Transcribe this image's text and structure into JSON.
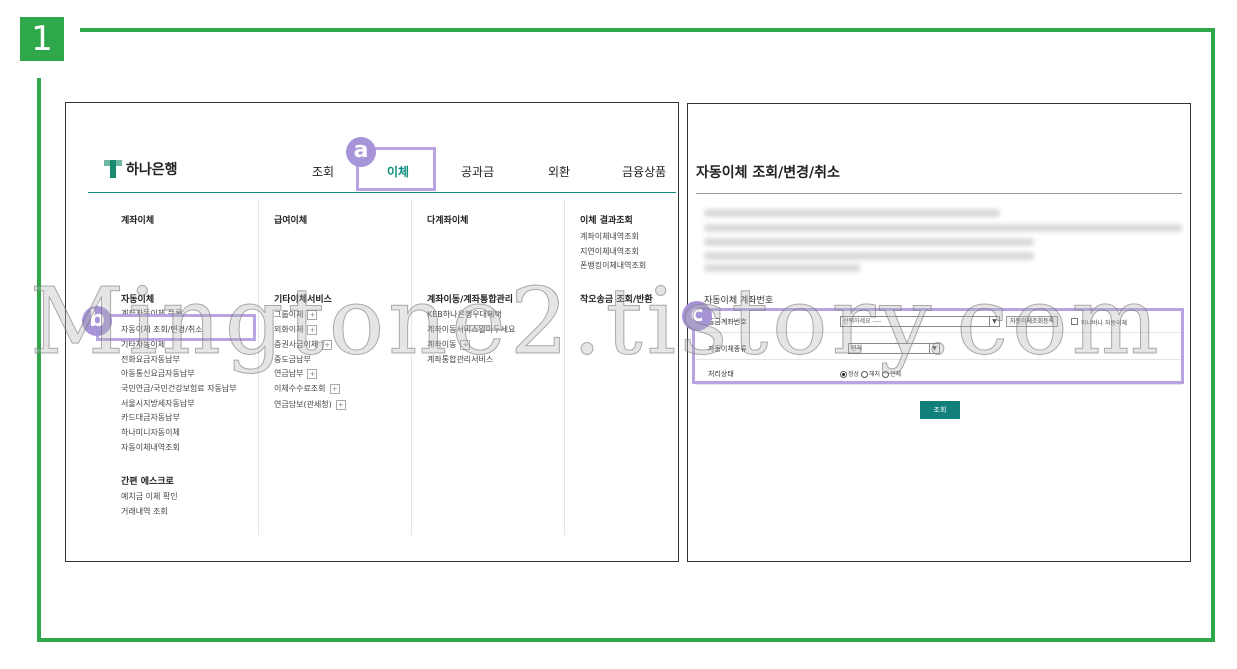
{
  "step": {
    "number": "1"
  },
  "colors": {
    "frame": "#2ea84a",
    "accent": "#0e8d7e",
    "highlight": "#b7a4e0",
    "button": "#11807a"
  },
  "markers": {
    "a": "a",
    "b": "b",
    "c": "c"
  },
  "bank": {
    "logo_icon": "hana-logo-icon",
    "logo_text": "하나은행",
    "nav": [
      "조회",
      "이체",
      "공과금",
      "외환",
      "금융상품"
    ],
    "active_nav": "이체",
    "menu": {
      "col1_head": "계좌이체",
      "col1_head2": "자동이체",
      "col1_items": [
        "계좌자동이체 등록",
        "자동이체 조회/변경/취소",
        "기타자동이체",
        "전화요금자동납부",
        "아동통신요금자동납부",
        "국민연금/국민건강보험료 자동납부",
        "서울시지방세자동납부",
        "카드대금자동납부",
        "하나미니자동이체",
        "자동이체내역조회"
      ],
      "col1_head3": "간편 에스크로",
      "col1_items2": [
        "예치금 이체 확인",
        "거래내역 조회"
      ],
      "col2_head": "급여이체",
      "col2_head2": "기타이체서비스",
      "col2_items": [
        "그룹이체",
        "외화이체",
        "증권사금이체",
        "중도금납부",
        "연금납부",
        "이체수수료조회",
        "연금담보(관세청)"
      ],
      "col3_head": "다계좌이체",
      "col3_head2": "계좌이동/계좌통합관리",
      "col3_items": [
        "KEB하나은행우대혜택",
        "계좌이동서비스알아두세요",
        "계좌이동",
        "계좌통합관리서비스"
      ],
      "col4_head": "이체 결과조회",
      "col4_items": [
        "계좌이체내역조회",
        "지연이체내역조회",
        "폰뱅킹이체내역조회"
      ],
      "col4_head2": "착오송금 조회/반환"
    }
  },
  "detail": {
    "title": "자동이체 조회/변경/취소",
    "section_label": "자동이체 계좌번호",
    "fields": {
      "account_label": "출금계좌번호",
      "account_value": "선택하세요 ----",
      "account_btn": "자동이체조회등록",
      "account_check": "하나바나 자동이체",
      "type_label": "자동이체종류",
      "type_value": "전체",
      "status_label": "처리상태",
      "status_options": [
        "정상",
        "해지",
        "전체"
      ]
    },
    "search_btn": "조회"
  },
  "watermark": "Mingtone2.tistory.com"
}
